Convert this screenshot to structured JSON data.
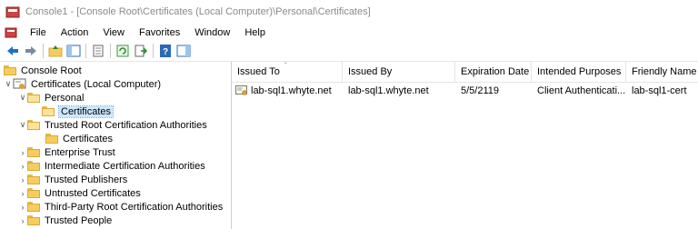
{
  "window": {
    "title": "Console1 - [Console Root\\Certificates (Local Computer)\\Personal\\Certificates]"
  },
  "menu": {
    "items": [
      "File",
      "Action",
      "View",
      "Favorites",
      "Window",
      "Help"
    ]
  },
  "toolbar": {
    "buttons": [
      "back-arrow-icon",
      "forward-arrow-icon",
      "up-folder-icon",
      "show-hide-tree-icon",
      "properties-icon",
      "refresh-icon",
      "export-list-icon",
      "help-icon",
      "action-pane-icon"
    ]
  },
  "tree": {
    "items": [
      {
        "label": "Console Root"
      },
      {
        "label": "Certificates (Local Computer)"
      },
      {
        "label": "Personal"
      },
      {
        "label": "Certificates"
      },
      {
        "label": "Trusted Root Certification Authorities"
      },
      {
        "label": "Certificates"
      },
      {
        "label": "Enterprise Trust"
      },
      {
        "label": "Intermediate Certification Authorities"
      },
      {
        "label": "Trusted Publishers"
      },
      {
        "label": "Untrusted Certificates"
      },
      {
        "label": "Third-Party Root Certification Authorities"
      },
      {
        "label": "Trusted People"
      }
    ]
  },
  "list": {
    "columns": [
      "Issued To",
      "Issued By",
      "Expiration Date",
      "Intended Purposes",
      "Friendly Name"
    ],
    "rows": [
      {
        "issued_to": "lab-sql1.whyte.net",
        "issued_by": "lab-sql1.whyte.net",
        "expiration": "5/5/2119",
        "purposes": "Client Authenticati...",
        "friendly": "lab-sql1-cert"
      }
    ]
  },
  "colors": {
    "selection": "#cce8ff",
    "folder": "#f5cd5e",
    "nav_arrow": "#1f6fc5"
  }
}
